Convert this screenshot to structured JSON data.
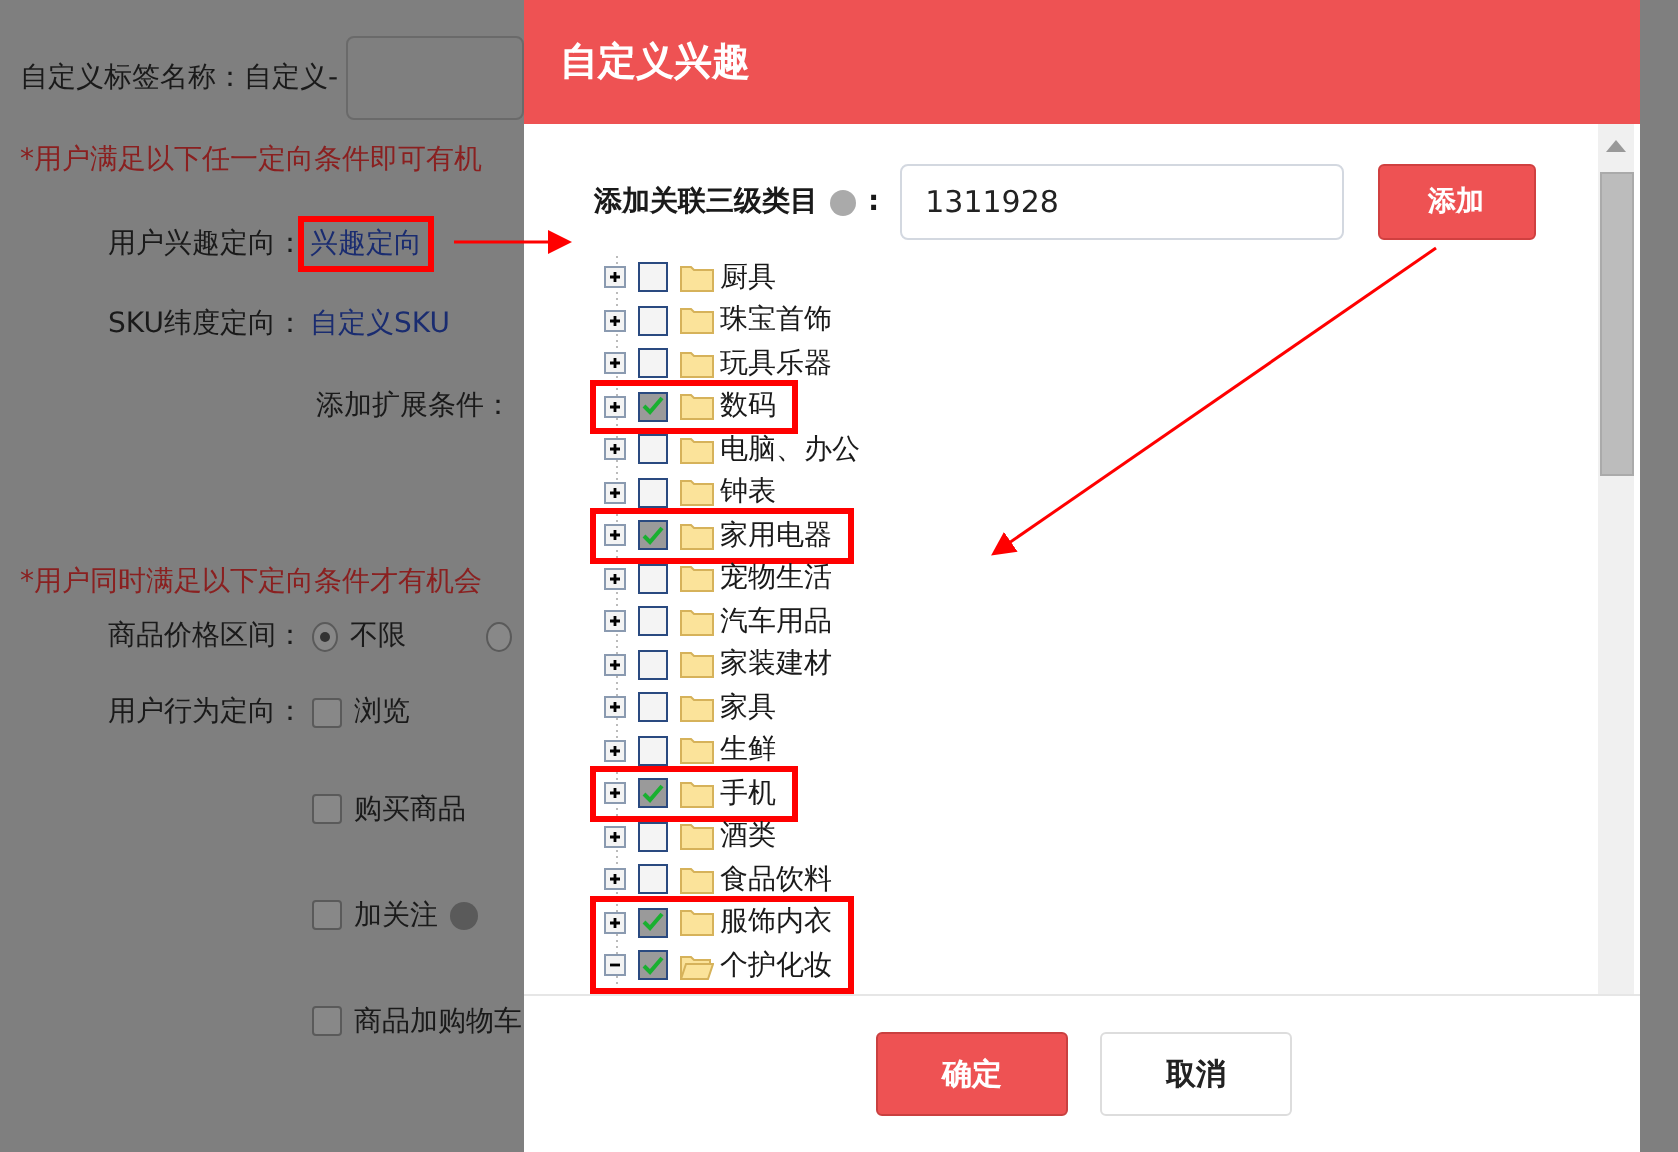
{
  "page": {
    "name_label": "自定义标签名称：",
    "name_value": "自定义-",
    "notice_any": "*用户满足以下任一定向条件即可有机",
    "interest_label": "用户兴趣定向：",
    "interest_link": {
      "text": "兴趣定向",
      "highlighted": true
    },
    "sku_label": "SKU纬度定向：",
    "sku_link": "自定义SKU",
    "extend_label": "添加扩展条件：",
    "notice_all": "*用户同时满足以下定向条件才有机会",
    "price_label": "商品价格区间：",
    "price_options": [
      {
        "label": "不限",
        "selected": true
      },
      {
        "selected": false
      }
    ],
    "behavior_label": "用户行为定向：",
    "behaviors": [
      {
        "label": "浏览",
        "checked": false,
        "help": false
      },
      {
        "label": "购买商品",
        "checked": false,
        "help": false
      },
      {
        "label": "加关注",
        "checked": false,
        "help": true
      },
      {
        "label": "商品加购物车",
        "checked": false,
        "help": false
      }
    ]
  },
  "dialog": {
    "title": "自定义兴趣",
    "field_label": "添加关联三级类目",
    "field_colon": ":",
    "field_value": "1311928",
    "add_button": "添加",
    "tree": [
      {
        "label": "厨具",
        "checked": false,
        "expanded": false,
        "highlighted": false
      },
      {
        "label": "珠宝首饰",
        "checked": false,
        "expanded": false,
        "highlighted": false
      },
      {
        "label": "玩具乐器",
        "checked": false,
        "expanded": false,
        "highlighted": false
      },
      {
        "label": "数码",
        "checked": true,
        "expanded": false,
        "highlighted": true
      },
      {
        "label": "电脑、办公",
        "checked": false,
        "expanded": false,
        "highlighted": false
      },
      {
        "label": "钟表",
        "checked": false,
        "expanded": false,
        "highlighted": false
      },
      {
        "label": "家用电器",
        "checked": true,
        "expanded": false,
        "highlighted": true
      },
      {
        "label": "宠物生活",
        "checked": false,
        "expanded": false,
        "highlighted": false
      },
      {
        "label": "汽车用品",
        "checked": false,
        "expanded": false,
        "highlighted": false
      },
      {
        "label": "家装建材",
        "checked": false,
        "expanded": false,
        "highlighted": false
      },
      {
        "label": "家具",
        "checked": false,
        "expanded": false,
        "highlighted": false
      },
      {
        "label": "生鲜",
        "checked": false,
        "expanded": false,
        "highlighted": false
      },
      {
        "label": "手机",
        "checked": true,
        "expanded": false,
        "highlighted": true
      },
      {
        "label": "酒类",
        "checked": false,
        "expanded": false,
        "highlighted": false
      },
      {
        "label": "食品饮料",
        "checked": false,
        "expanded": false,
        "highlighted": false
      },
      {
        "label": "服饰内衣",
        "checked": true,
        "expanded": false,
        "highlighted": true
      },
      {
        "label": "个护化妆",
        "checked": true,
        "expanded": true,
        "highlighted": true
      }
    ],
    "confirm_button": "确定",
    "cancel_button": "取消"
  }
}
